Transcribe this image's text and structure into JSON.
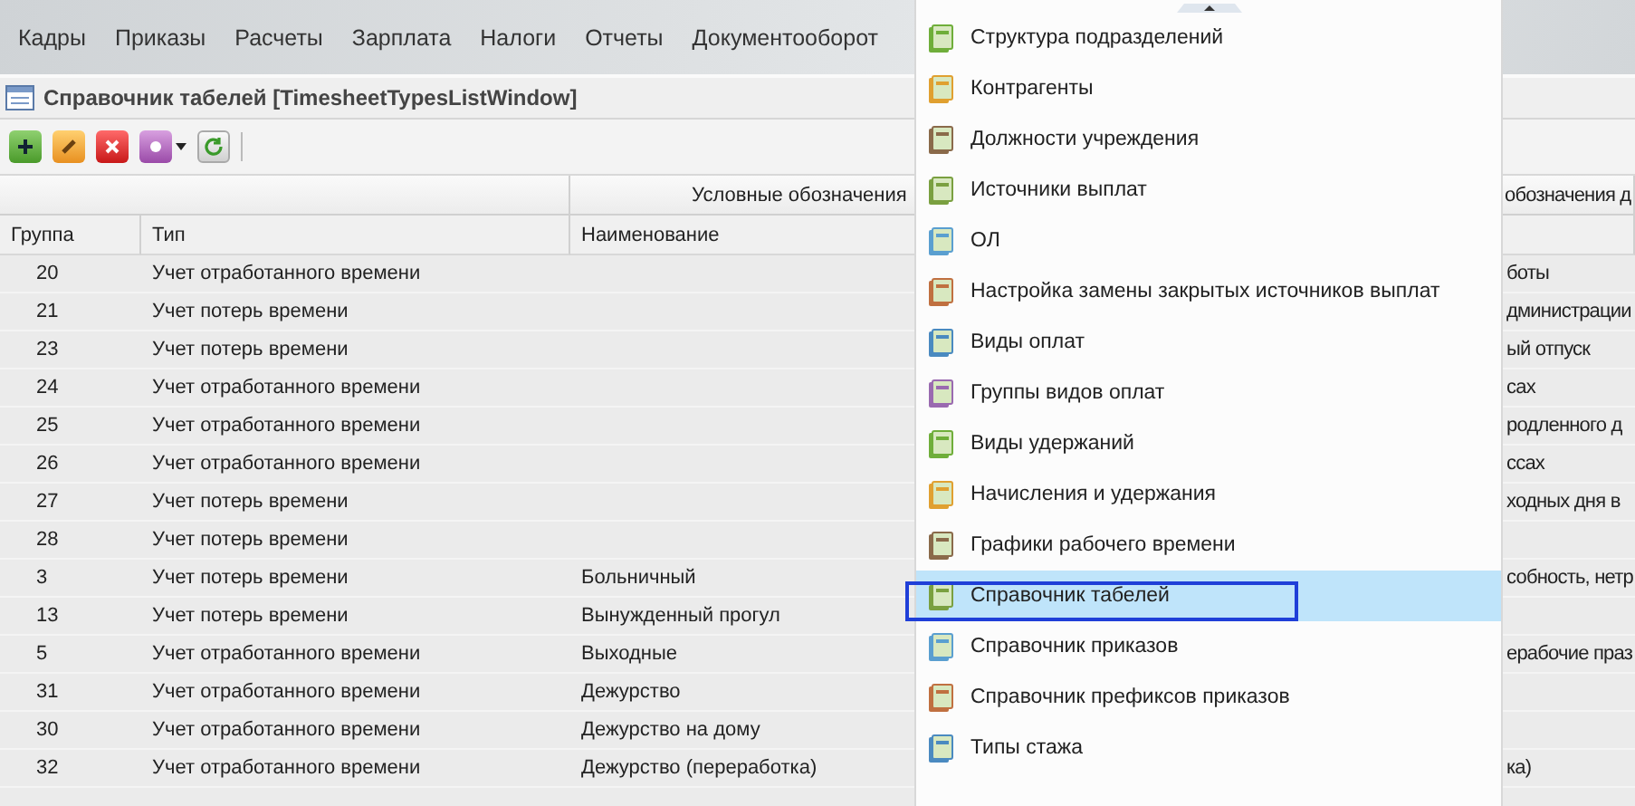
{
  "menu_bar": [
    "Кадры",
    "Приказы",
    "Расчеты",
    "Зарплата",
    "Налоги",
    "Отчеты",
    "Документооборот"
  ],
  "window": {
    "title": "Справочник табелей [TimesheetTypesListWindow]"
  },
  "table": {
    "group_headers": [
      "Условные обозначения",
      "обозначения д"
    ],
    "columns": [
      "Группа",
      "Тип",
      "Наименование"
    ],
    "rows": [
      {
        "group": "20",
        "type": "Учет отработанного времени",
        "name": "",
        "column_5": "боты"
      },
      {
        "group": "21",
        "type": "Учет потерь времени",
        "name": "",
        "column_5": "дминистрации"
      },
      {
        "group": "23",
        "type": "Учет потерь времени",
        "name": "",
        "column_5": "ый отпуск"
      },
      {
        "group": "24",
        "type": "Учет отработанного времени",
        "name": "",
        "column_5": "сах"
      },
      {
        "group": "25",
        "type": "Учет отработанного времени",
        "name": "",
        "column_5": "родленного д"
      },
      {
        "group": "26",
        "type": "Учет отработанного времени",
        "name": "",
        "column_5": "ссах"
      },
      {
        "group": "27",
        "type": "Учет потерь времени",
        "name": "",
        "column_5": "ходных дня в"
      },
      {
        "group": "28",
        "type": "Учет потерь времени",
        "name": "",
        "column_5": ""
      },
      {
        "group": "3",
        "type": "Учет потерь времени",
        "name": "Больничный",
        "column_5": "собность, нетр"
      },
      {
        "group": "13",
        "type": "Учет потерь времени",
        "name": "Вынужденный прогул",
        "column_5": ""
      },
      {
        "group": "5",
        "type": "Учет отработанного времени",
        "name": "Выходные",
        "column_5": "ерабочие праз"
      },
      {
        "group": "31",
        "type": "Учет отработанного времени",
        "name": "Дежурство",
        "column_5": ""
      },
      {
        "group": "30",
        "type": "Учет отработанного времени",
        "name": "Дежурство на дому",
        "column_5": ""
      },
      {
        "group": "32",
        "type": "Учет отработанного времени",
        "name": "Дежурство (переработка)",
        "column_5": "ка)"
      }
    ]
  },
  "dropdown_menu": {
    "items": [
      {
        "label": "Структура подразделений",
        "selected": false
      },
      {
        "label": "Контрагенты",
        "selected": false
      },
      {
        "label": "Должности учреждения",
        "selected": false
      },
      {
        "label": "Источники выплат",
        "selected": false
      },
      {
        "label": "ОЛ",
        "selected": false
      },
      {
        "label": "Настройка замены закрытых источников выплат",
        "selected": false
      },
      {
        "label": "Виды оплат",
        "selected": false
      },
      {
        "label": "Группы видов оплат",
        "selected": false
      },
      {
        "label": "Виды удержаний",
        "selected": false
      },
      {
        "label": "Начисления и удержания",
        "selected": false
      },
      {
        "label": "Графики рабочего времени",
        "selected": false
      },
      {
        "label": "Справочник табелей",
        "selected": true
      },
      {
        "label": "Справочник приказов",
        "selected": false
      },
      {
        "label": "Справочник префиксов приказов",
        "selected": false
      },
      {
        "label": "Типы стажа",
        "selected": false
      }
    ]
  }
}
